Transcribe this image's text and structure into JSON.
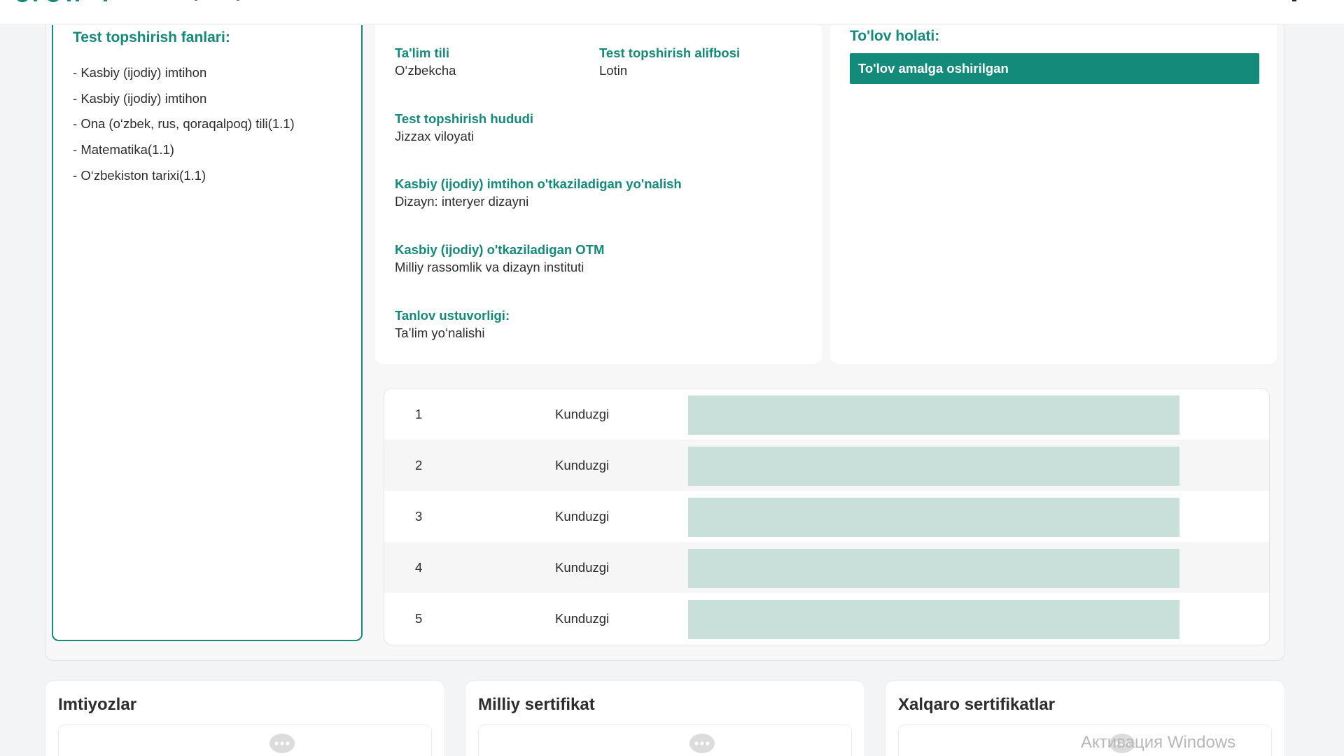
{
  "subjects": {
    "title": "Test topshirish fanlari:",
    "items": [
      "Kasbiy (ijodiy) imtihon",
      "Kasbiy (ijodiy) imtihon",
      "Ona (o‘zbek, rus, qoraqalpoq) tili(1.1)",
      "Matematika(1.1)",
      "O‘zbekiston tarixi(1.1)"
    ]
  },
  "info": {
    "fields": [
      {
        "label": "Ta'lim tili",
        "value": "O‘zbekcha"
      },
      {
        "label": "Test topshirish alifbosi",
        "value": "Lotin"
      },
      {
        "label": "Test topshirish hududi",
        "value": "Jizzax viloyati"
      },
      {
        "label": "Kasbiy (ijodiy) imtihon o'tkaziladigan yo'nalish",
        "value": "Dizayn: interyer dizayni"
      },
      {
        "label": "Kasbiy (ijodiy) o'tkaziladigan OTM",
        "value": "Milliy rassomlik va dizayn instituti"
      },
      {
        "label": "Tanlov ustuvorligi:",
        "value": "Ta’lim yo‘nalishi"
      }
    ]
  },
  "payment": {
    "title": "To'lov holati:",
    "status": "To'lov amalga oshirilgan"
  },
  "choices": [
    {
      "num": "1",
      "type": "Kunduzgi"
    },
    {
      "num": "2",
      "type": "Kunduzgi"
    },
    {
      "num": "3",
      "type": "Kunduzgi"
    },
    {
      "num": "4",
      "type": "Kunduzgi"
    },
    {
      "num": "5",
      "type": "Kunduzgi"
    }
  ],
  "bottom": {
    "privileges": "Imtiyozlar",
    "national_cert": "Milliy sertifikat",
    "intl_cert": "Xalqaro sertifikatlar"
  },
  "watermark": "Активация Windows",
  "colors": {
    "accent": "#138b7a",
    "bar_fill": "#c9e0da"
  },
  "icons": {
    "chat": "chat-bubble-icon"
  }
}
